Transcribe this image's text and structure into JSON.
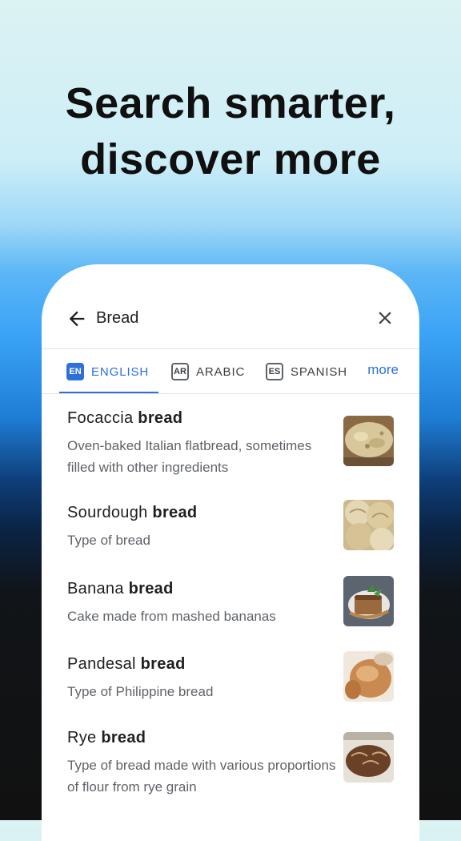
{
  "headline": {
    "line1": "Search smarter,",
    "line2": "discover more"
  },
  "search": {
    "query": "Bread"
  },
  "tabs": [
    {
      "code": "EN",
      "label": "ENGLISH",
      "active": true
    },
    {
      "code": "AR",
      "label": "ARABIC",
      "active": false
    },
    {
      "code": "ES",
      "label": "SPANISH",
      "active": false
    }
  ],
  "more_label": "more",
  "results": [
    {
      "prefix": "Focaccia ",
      "bold": "bread",
      "description": "Oven-baked Italian flatbread, sometimes filled with other ingredients",
      "thumb_icon": "focaccia-image"
    },
    {
      "prefix": "Sourdough ",
      "bold": "bread",
      "description": "Type of bread",
      "thumb_icon": "sourdough-image"
    },
    {
      "prefix": "Banana ",
      "bold": "bread",
      "description": "Cake made from mashed bananas",
      "thumb_icon": "banana-bread-image"
    },
    {
      "prefix": "Pandesal ",
      "bold": "bread",
      "description": "Type of Philippine bread",
      "thumb_icon": "pandesal-image"
    },
    {
      "prefix": "Rye ",
      "bold": "bread",
      "description": "Type of bread made with various proportions of flour from rye grain",
      "thumb_icon": "rye-bread-image"
    }
  ],
  "colors": {
    "accent": "#2e6fd8",
    "text_primary": "#1f1f1f",
    "text_secondary": "#5f6368"
  }
}
